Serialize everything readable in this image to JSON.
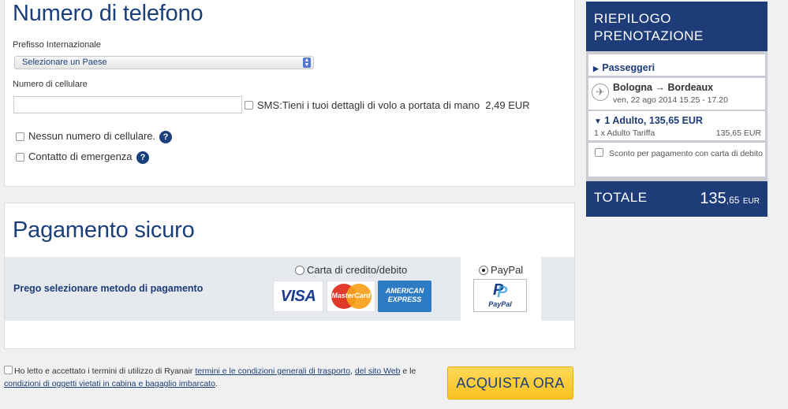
{
  "phone": {
    "title": "Numero di telefono",
    "prefix_label": "Prefisso Internazionale",
    "prefix_select": "Selezionare un Paese",
    "mobile_label": "Numero di cellulare",
    "mobile_value": "",
    "sms_label": "SMS:Tieni i tuoi dettagli di volo a portata di mano",
    "sms_price": "2,49 EUR",
    "no_mobile_label": "Nessun numero di cellulare.",
    "emergency_label": "Contatto di emergenza",
    "help_glyph": "?"
  },
  "payment": {
    "title": "Pagamento sicuro",
    "prompt": "Prego selezionare metodo di pagamento",
    "option_card": "Carta di credito/debito",
    "option_paypal": "PayPal",
    "selected": "PayPal",
    "cards": {
      "visa": "VISA",
      "mastercard": "MasterCard",
      "amex_line1": "AMERICAN",
      "amex_line2": "EXPRESS"
    },
    "paypal_logo_text": "PayPal"
  },
  "legal": {
    "prefix": "Ho letto e accettato i termini di utilizzo di Ryanair",
    "link1": "termini e le condizioni generali di trasporto",
    "sep": ",",
    "link2": "del sito Web",
    "middle": "e le",
    "link3": "condizioni di oggetti vietati in cabina e bagaglio imbarcato",
    "end": "."
  },
  "buy_button": "ACQUISTA ORA",
  "summary": {
    "title_line1": "RIEPILOGO",
    "title_line2": "PRENOTAZIONE",
    "passengers_label": "Passeggeri",
    "route": "Bologna → Bordeaux",
    "datetime": "ven, 22 ago 2014 15.25 - 17.20",
    "adult_header": "1 Adulto, 135,65 EUR",
    "adult_line_label": "1 x Adulto Tariffa",
    "adult_line_price": "135,65 EUR",
    "discount_label": "Sconto per pagamento con carta di debito",
    "total_label": "TOTALE",
    "total_int": "135",
    "total_dec": ",65",
    "total_cur": "EUR"
  },
  "colors": {
    "brand_blue": "#1d3c78",
    "buy_yellow": "#f8c21f"
  },
  "icons": [
    "chevron-down-icon",
    "help-icon",
    "plane-icon",
    "caret-right-icon",
    "caret-down-icon"
  ]
}
